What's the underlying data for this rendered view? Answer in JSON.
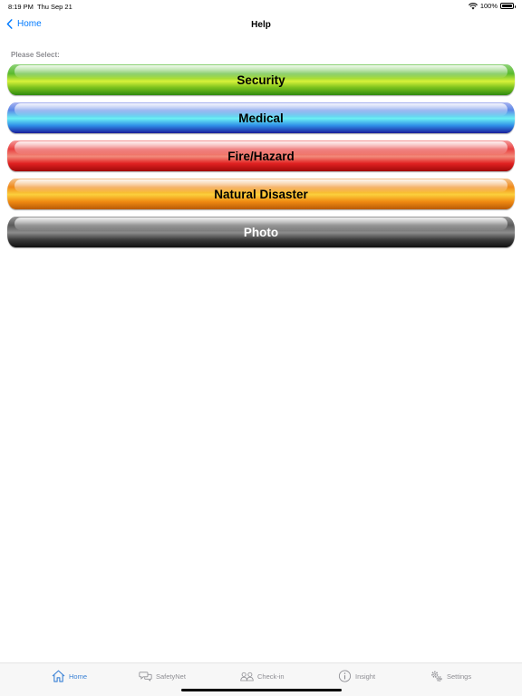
{
  "status_bar": {
    "time": "8:19 PM",
    "date": "Thu Sep 21",
    "battery": "100%"
  },
  "nav": {
    "back_label": "Home",
    "title": "Help"
  },
  "prompt": "Please Select:",
  "menu": [
    {
      "label": "Security"
    },
    {
      "label": "Medical"
    },
    {
      "label": "Fire/Hazard"
    },
    {
      "label": "Natural Disaster"
    },
    {
      "label": "Photo"
    }
  ],
  "tabs": [
    {
      "label": "Home",
      "icon": "house-icon",
      "active": true
    },
    {
      "label": "SafetyNet",
      "icon": "chat-bubbles-icon",
      "active": false
    },
    {
      "label": "Check-in",
      "icon": "people-icon",
      "active": false
    },
    {
      "label": "Insight",
      "icon": "info-icon",
      "active": false
    },
    {
      "label": "Settings",
      "icon": "gears-icon",
      "active": false
    }
  ],
  "colors": {
    "accent": "#007aff",
    "tab_active": "#3b82d6",
    "tab_inactive": "#8e8e93",
    "security": "#5aba2e",
    "medical": "#2f8fe8",
    "fire": "#e02020",
    "natural": "#f08a12",
    "photo": "#3a3a3a"
  }
}
